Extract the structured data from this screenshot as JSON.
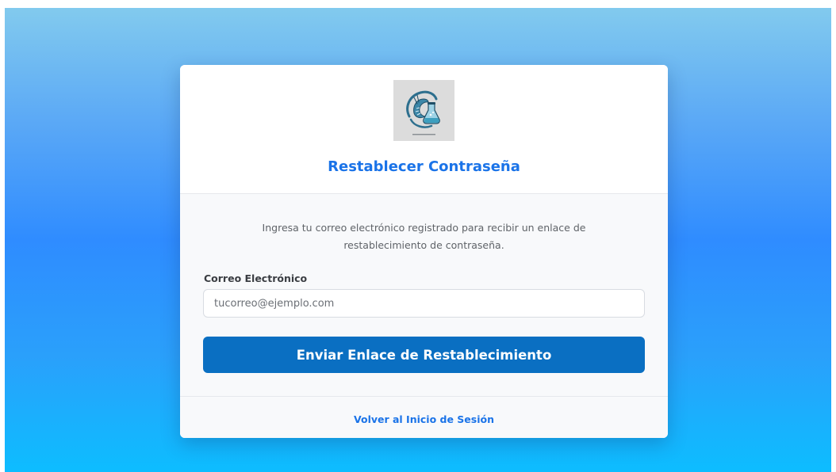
{
  "card": {
    "logo": {
      "icon": "shrimp-flask-logo-icon"
    },
    "title": "Restablecer Contraseña",
    "description": "Ingresa tu correo electrónico registrado para recibir un enlace de restablecimiento de contraseña.",
    "email_label": "Correo Electrónico",
    "email_placeholder": "tucorreo@ejemplo.com",
    "email_value": "",
    "submit_label": "Enviar Enlace de Restablecimiento",
    "back_link_label": "Volver al Inicio de Sesión"
  },
  "colors": {
    "accent": "#1a73e8",
    "button": "#0a6fc2",
    "background_top": "#82caee",
    "background_bottom": "#0dbdff"
  }
}
